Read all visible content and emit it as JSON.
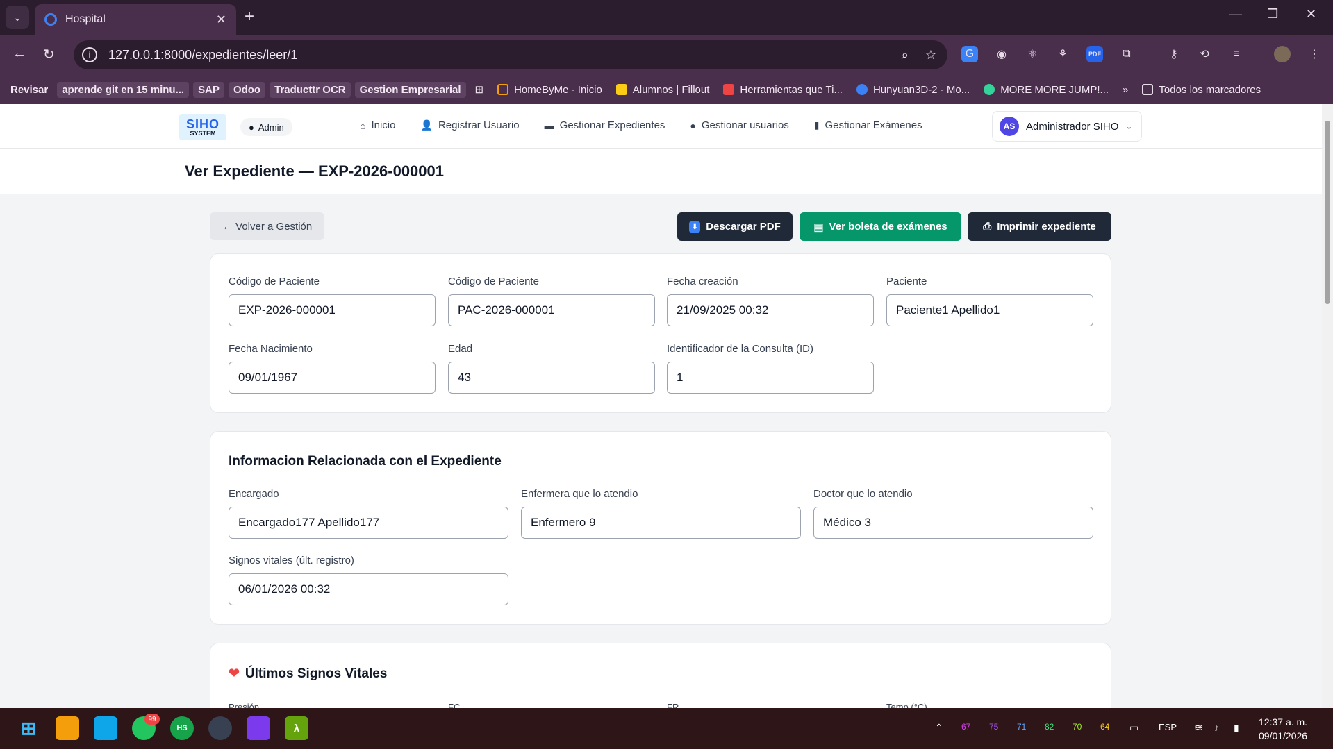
{
  "browser": {
    "tab_title": "Hospital",
    "url": "127.0.0.1:8000/expedientes/leer/1",
    "bookmarks": [
      "Revisar",
      "aprende git en 15 minu...",
      "SAP",
      "Odoo",
      "Traducttr OCR",
      "Gestion Empresarial",
      "HomeByMe - Inicio",
      "Alumnos | Fillout",
      "Herramientas que Ti...",
      "Hunyuan3D-2 - Mo...",
      "MORE MORE JUMP!...",
      "Todos los marcadores"
    ]
  },
  "header": {
    "logo_top": "SIHO",
    "logo_bottom": "SYSTEM",
    "role": "Admin",
    "nav": [
      "Inicio",
      "Registrar Usuario",
      "Gestionar Expedientes",
      "Gestionar usuarios",
      "Gestionar Exámenes"
    ],
    "user_initials": "AS",
    "user_name": "Administrador SIHO"
  },
  "page": {
    "title": "Ver Expediente — EXP-2026-000001",
    "back_label": "← Volver a Gestión",
    "actions": {
      "pdf": "Descargar PDF",
      "boleta": "Ver boleta de exámenes",
      "imprimir": "Imprimir expediente"
    },
    "colors": {
      "dark": "#1f2937",
      "green": "#059669"
    }
  },
  "card1": {
    "fields": [
      {
        "label": "Código de Paciente",
        "value": "EXP-2026-000001"
      },
      {
        "label": "Código de Paciente",
        "value": "PAC-2026-000001"
      },
      {
        "label": "Fecha creación",
        "value": "21/09/2025 00:32"
      },
      {
        "label": "Paciente",
        "value": "Paciente1 Apellido1"
      },
      {
        "label": "Fecha Nacimiento",
        "value": "09/01/1967"
      },
      {
        "label": "Edad",
        "value": "43"
      },
      {
        "label": "Identificador de la Consulta (ID)",
        "value": "1"
      }
    ]
  },
  "card2": {
    "title": "Informacion Relacionada con el Expediente",
    "fields": [
      {
        "label": "Encargado",
        "value": "Encargado177 Apellido177"
      },
      {
        "label": "Enfermera que lo atendio",
        "value": "Enfermero 9"
      },
      {
        "label": "Doctor que lo atendio",
        "value": "Médico 3"
      },
      {
        "label": "Signos vitales (últ. registro)",
        "value": "06/01/2026 00:32"
      }
    ]
  },
  "card3": {
    "title": "Últimos Signos Vitales",
    "labels": [
      "Presión",
      "FC",
      "FR",
      "Temp (°C)"
    ]
  },
  "taskbar": {
    "whatsapp_badge": "99",
    "tray_numbers": [
      "67",
      "75",
      "71",
      "82",
      "70",
      "64"
    ],
    "lang": "ESP",
    "time": "12:37 a. m.",
    "date": "09/01/2026"
  }
}
